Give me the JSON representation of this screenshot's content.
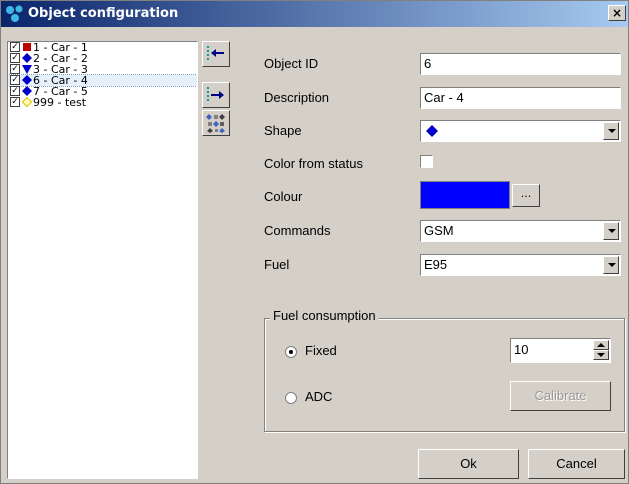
{
  "window": {
    "title": "Object configuration",
    "close_label": "×"
  },
  "objects": [
    {
      "label": "1 - Car - 1",
      "checked": true,
      "shape": "square",
      "color": "#c00000"
    },
    {
      "label": "2 - Car - 2",
      "checked": true,
      "shape": "diamond",
      "color": "#0000c8"
    },
    {
      "label": "3 - Car - 3",
      "checked": true,
      "shape": "triangle-down",
      "color": "#0000c8"
    },
    {
      "label": "6 - Car - 4",
      "checked": true,
      "shape": "diamond",
      "color": "#0000c8",
      "selected": true
    },
    {
      "label": "7 - Car - 5",
      "checked": true,
      "shape": "diamond",
      "color": "#0000c8"
    },
    {
      "label": "999 - test",
      "checked": true,
      "shape": "diamond-outline",
      "color": "#e8c800"
    }
  ],
  "form": {
    "object_id_label": "Object ID",
    "object_id_value": "6",
    "description_label": "Description",
    "description_value": "Car - 4",
    "shape_label": "Shape",
    "color_from_status_label": "Color from status",
    "colour_label": "Colour",
    "colour_value": "#0000ff",
    "ellipsis_label": "...",
    "commands_label": "Commands",
    "commands_value": "GSM",
    "fuel_label": "Fuel",
    "fuel_value": "E95"
  },
  "fuel_consumption": {
    "legend": "Fuel consumption",
    "fixed_label": "Fixed",
    "fixed_value": "10",
    "adc_label": "ADC",
    "calibrate_label": "Calibrate"
  },
  "buttons": {
    "ok_label": "Ok",
    "cancel_label": "Cancel"
  }
}
